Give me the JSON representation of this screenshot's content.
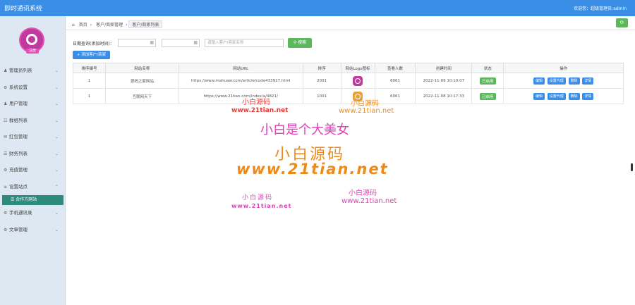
{
  "header": {
    "title": "即时通讯系统",
    "user": "欢迎您：超级管理员:admin"
  },
  "sidebar": {
    "logo_badge": "注册",
    "items": [
      {
        "icon": "user-icon",
        "glyph": "♟",
        "label": "管理员列表"
      },
      {
        "icon": "gear-icon",
        "glyph": "⚙",
        "label": "系统设置"
      },
      {
        "icon": "user-icon",
        "glyph": "♟",
        "label": "用户管理"
      },
      {
        "icon": "chat-icon",
        "glyph": "☷",
        "label": "群组列表"
      },
      {
        "icon": "message-icon",
        "glyph": "✉",
        "label": "红包管理"
      },
      {
        "icon": "list-icon",
        "glyph": "☰",
        "label": "财务列表"
      },
      {
        "icon": "gear-icon",
        "glyph": "⚙",
        "label": "充值管理"
      },
      {
        "icon": "link-icon",
        "glyph": "≡",
        "label": "设置站点"
      }
    ],
    "sub_active": "合作方网站",
    "items_after": [
      {
        "icon": "gear-icon",
        "glyph": "⚙",
        "label": "手机通讯录"
      },
      {
        "icon": "gear-icon",
        "glyph": "⚙",
        "label": "文章管理"
      }
    ]
  },
  "breadcrumb": {
    "home": "首页",
    "c1": "客户/商家管理",
    "c2": "客户/商家列表"
  },
  "filter": {
    "label": "日期查询(添加时间)：",
    "date_from_placeholder": "",
    "date_to_placeholder": "",
    "search_placeholder": "请输入客户/商家名称",
    "search_button": "搜索"
  },
  "add_button": "+ 添加客户/商家",
  "table": {
    "headers": [
      "排序编号",
      "网站名称",
      "网站URL",
      "排序",
      "网站Logo图标",
      "查看人数",
      "创建时间",
      "状态",
      "操作"
    ],
    "rows": [
      {
        "no": "1",
        "name": "源码之家网站",
        "url": "https://www.mahuaw.com/article/code433927.html",
        "sort": "2001",
        "views": "6061",
        "time": "2022-11-09 10:10:07",
        "status": "已启用",
        "actions": [
          "编辑",
          "设置代理",
          "删除",
          "详情"
        ]
      },
      {
        "no": "1",
        "name": "互联网天下",
        "url": "https://www.21tian.com/index/a/4821/",
        "sort": "1001",
        "views": "6061",
        "time": "2022-11-08 10:17:33",
        "status": "已启用",
        "actions": [
          "编辑",
          "设置代理",
          "删除",
          "详情"
        ]
      }
    ]
  },
  "watermarks": {
    "small_site_1": "小白源码",
    "small_url_1": "www.21tian.net",
    "small_site_2": "小白源码",
    "small_url_2": "www.21tian.net",
    "slogan": "小白是个大美女",
    "big_site": "小白源码",
    "big_url": "www.21tian.net",
    "small_site_3": "小白源码",
    "small_url_3": "www.21tian.net",
    "small_site_4": "小白源码",
    "small_url_4": "www.21tian.net"
  }
}
